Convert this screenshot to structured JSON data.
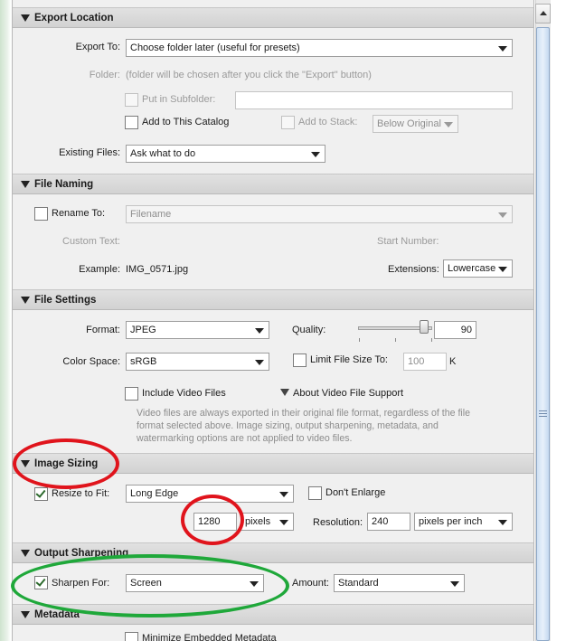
{
  "export_location": {
    "title": "Export Location",
    "export_to_label": "Export To:",
    "export_to_value": "Choose folder later (useful for presets)",
    "folder_label": "Folder:",
    "folder_value": "(folder will be chosen after you click the \"Export\" button)",
    "subfolder_label": "Put in Subfolder:",
    "subfolder_value": "",
    "add_catalog_label": "Add to This Catalog",
    "add_stack_label": "Add to Stack:",
    "stack_position_value": "Below Original",
    "existing_files_label": "Existing Files:",
    "existing_files_value": "Ask what to do"
  },
  "file_naming": {
    "title": "File Naming",
    "rename_label": "Rename To:",
    "rename_value": "Filename",
    "custom_text_label": "Custom Text:",
    "start_number_label": "Start Number:",
    "example_label": "Example:",
    "example_value": "IMG_0571.jpg",
    "extensions_label": "Extensions:",
    "extensions_value": "Lowercase"
  },
  "file_settings": {
    "title": "File Settings",
    "format_label": "Format:",
    "format_value": "JPEG",
    "quality_label": "Quality:",
    "quality_value": "90",
    "color_space_label": "Color Space:",
    "color_space_value": "sRGB",
    "limit_size_label": "Limit File Size To:",
    "limit_size_value": "100",
    "limit_size_unit": "K",
    "include_video_label": "Include Video Files",
    "about_video_label": "About Video File Support",
    "video_note": "Video files are always exported in their original file format, regardless of the file format selected above. Image sizing, output sharpening, metadata, and watermarking options are not applied to video files."
  },
  "image_sizing": {
    "title": "Image Sizing",
    "resize_label": "Resize to Fit:",
    "resize_value": "Long Edge",
    "dont_enlarge_label": "Don't Enlarge",
    "size_value": "1280",
    "size_unit_value": "pixels",
    "resolution_label": "Resolution:",
    "resolution_value": "240",
    "resolution_unit_value": "pixels per inch"
  },
  "output_sharpening": {
    "title": "Output Sharpening",
    "sharpen_label": "Sharpen For:",
    "sharpen_value": "Screen",
    "amount_label": "Amount:",
    "amount_value": "Standard"
  },
  "metadata": {
    "title": "Metadata",
    "minimize_label": "Minimize Embedded Metadata"
  },
  "colors": {
    "annotation_red": "#e0141c",
    "annotation_green": "#1fa83a",
    "checkmark": "#2d6a2d"
  },
  "icons": [
    "disclosure-triangle-icon",
    "dropdown-arrow-icon",
    "checkmark-icon",
    "scroll-up-arrow-icon"
  ]
}
